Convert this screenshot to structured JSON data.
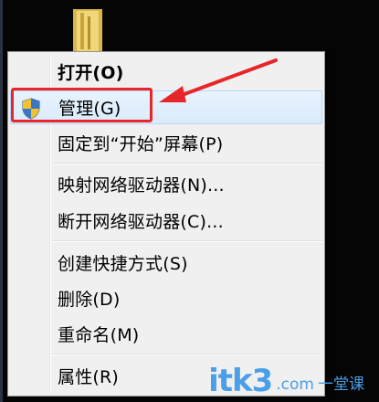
{
  "context_menu": {
    "items": [
      {
        "label": "打开(O)",
        "bold": true
      },
      {
        "label": "管理(G)",
        "icon": "uac-shield-icon",
        "highlighted": true
      },
      {
        "label": "固定到“开始”屏幕(P)"
      },
      {
        "label": "映射网络驱动器(N)..."
      },
      {
        "label": "断开网络驱动器(C)..."
      },
      {
        "label": "创建快捷方式(S)"
      },
      {
        "label": "删除(D)"
      },
      {
        "label": "重命名(M)"
      },
      {
        "label": "属性(R)"
      }
    ]
  },
  "watermark": {
    "logo": "itk3",
    "suffix": ".com",
    "tagline": "一堂课"
  },
  "colors": {
    "annotation": "#e8262a",
    "menu_bg": "#f0f0f0",
    "hover_bg": "#d9ebfb",
    "watermark": "#4a9fe8"
  }
}
